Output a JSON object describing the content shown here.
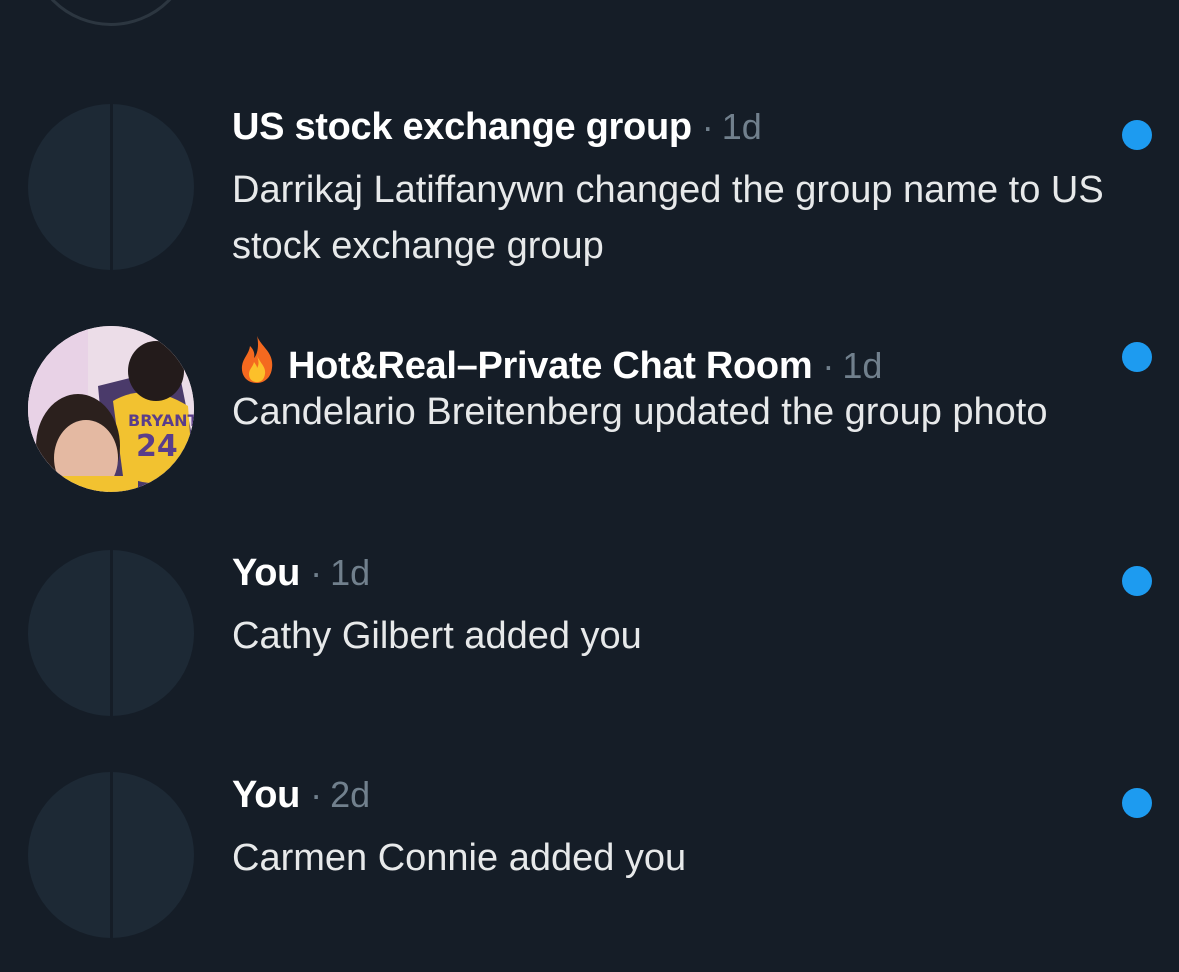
{
  "conversations": [
    {
      "name": "US stock exchange group",
      "separator": "·",
      "time": "1d",
      "message": "Darrikaj Latiffanywn changed the group name to US stock exchange group",
      "unread": true
    },
    {
      "icon": "fire-emoji",
      "name": "Hot&Real–Private Chat Room",
      "separator": "·",
      "time": "1d",
      "message": "Candelario Breitenberg updated the group photo",
      "unread": true
    },
    {
      "name": "You",
      "separator": "·",
      "time": "1d",
      "message": "Cathy Gilbert added you",
      "unread": true
    },
    {
      "name": "You",
      "separator": "·",
      "time": "2d",
      "message": "Carmen Connie added you",
      "unread": true
    }
  ],
  "colors": {
    "background": "#151d27",
    "unread_dot": "#1d9bf0",
    "secondary_text": "#71808d"
  }
}
